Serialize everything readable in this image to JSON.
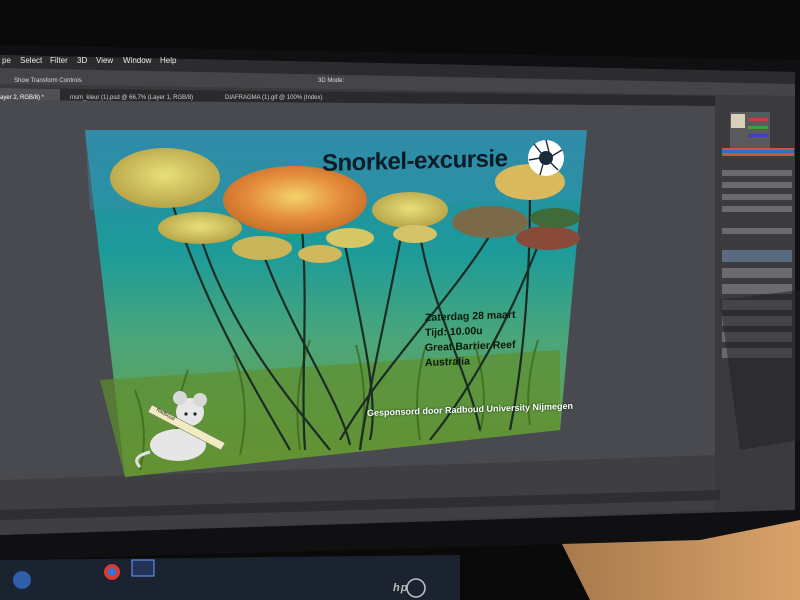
{
  "photo": {
    "palette": {
      "bezel": "#0b0b0c",
      "photoshop_ui": "#3a3a3d",
      "canvas_bg": "#494a4f",
      "water_teal": "#1f8a8c",
      "water_green": "#7fae5a",
      "lily_orange": "#e38a3a",
      "lily_yellow": "#d4c063",
      "desk_wood": "#c58f5c"
    }
  },
  "menu": [
    "pe",
    "Select",
    "Filter",
    "3D",
    "View",
    "Window",
    "Help"
  ],
  "options_bar": {
    "show_transform": "Show Transform Controls",
    "mode_3d": "3D Mode:"
  },
  "tabs": [
    "ayer 2, RGB/8) *",
    "msm_kleur (1).psd @ 66.7% (Layer 1, RGB/8)",
    "DIAFRAGMA (1).gif @ 100% (Index)"
  ],
  "poster": {
    "title": "Snorkel-excursie",
    "event_lines": [
      "Zaterdag 28 maart",
      "Tijd: 10.00u",
      "Great Barrier Reef",
      "Australia"
    ],
    "sponsor": "Gesponsord door Radboud University Nijmegen",
    "mouse_label": "Radboud"
  },
  "monitor": {
    "brand": "hp"
  },
  "icons": [
    "aperture-logo-icon",
    "mouse-illustration-icon",
    "windows-start-icon",
    "chrome-icon",
    "photoshop-icon"
  ]
}
